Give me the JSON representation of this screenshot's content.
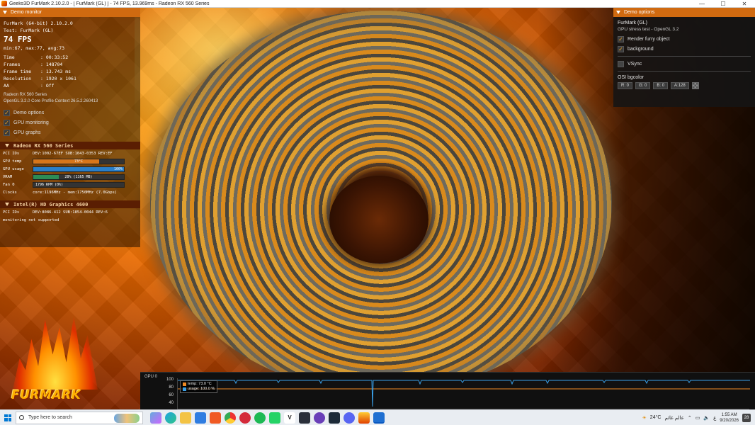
{
  "window": {
    "title": "Geeks3D FurMark 2.10.2.0 - [ FurMark (GL) ] - 74 FPS, 13.969ms - Radeon RX 560 Series",
    "minimize": "—",
    "maximize": "☐",
    "close": "✕"
  },
  "monitor": {
    "header": "Demo monitor",
    "app_line": "FurMark (64-bit) 2.10.2.0",
    "test_line": "Test: FurMark (GL)",
    "fps": "74 FPS",
    "fps_stats": "min:67, max:77, avg:73",
    "stats": [
      {
        "k": "Time",
        "v": ": 00:33:52"
      },
      {
        "k": "Frames",
        "v": ": 148704"
      },
      {
        "k": "Frame time",
        "v": ": 13.743 ms"
      },
      {
        "k": "Resolution",
        "v": ": 1920 x 1061"
      },
      {
        "k": "AA",
        "v": ": Off"
      }
    ],
    "gpu_name": "Radeon RX 560 Series",
    "opengl": "OpenGL 3.2.0 Core Profile Context 26.5.2.260413",
    "checks": [
      {
        "label": "Demo options",
        "checked": true
      },
      {
        "label": "GPU monitoring",
        "checked": true
      },
      {
        "label": "GPU graphs",
        "checked": true
      }
    ],
    "gpu1": {
      "header": "Radeon RX 560 Series",
      "pci_key": "PCI IDs",
      "pci_val": "DEV:1002-67EF SUB:1043-0353 REV:EF",
      "temp_key": "GPU temp",
      "temp_val": "73°C",
      "temp_frac": 0.73,
      "usage_key": "GPU usage",
      "usage_val": "100%",
      "usage_frac": 1.0,
      "vram_key": "VRAM",
      "vram_val": "28% (1165 MB)",
      "vram_frac": 0.28,
      "fan_key": "Fan 0",
      "fan_val": "1796 RPM (0%)",
      "clocks_key": "Clocks",
      "clocks_val": "core:1196MHz - mem:1750MHz (7.0Gbps)"
    },
    "gpu2": {
      "header": "Intel(R) HD Graphics 4600",
      "pci_key": "PCI IDs",
      "pci_val": "DEV:8086-412 SUB:1854-0044 REV:6",
      "note": "monitoring not supported"
    }
  },
  "logo": {
    "word": "FURMARK"
  },
  "options": {
    "header": "Demo options",
    "title": "FurMark (GL)",
    "subtitle": "GPU stress test - OpenGL 3.2",
    "checks": [
      {
        "label": "Render furry object",
        "checked": true
      },
      {
        "label": "background",
        "checked": true
      }
    ],
    "vsync": "VSync",
    "bgcolor_label": "OSI bgcolor",
    "bgcolor": [
      "R: 0",
      "G: 0",
      "B: 0",
      "A:128"
    ]
  },
  "graph": {
    "label": "GPU 0",
    "yticks": [
      "100",
      "80",
      "60",
      "40"
    ],
    "legend": [
      {
        "name": "temp: 73.0 °C",
        "color": "#f08a24"
      },
      {
        "name": "usage: 100.0 %",
        "color": "#3aa0e8"
      }
    ]
  },
  "taskbar": {
    "search_placeholder": "Type here to search",
    "weather": "24°C",
    "weather_text": "عالم غائم",
    "lang": "ع",
    "time": "1:55 AM",
    "date": "9/20/2026",
    "notif_count": "28",
    "icons": [
      "copilot-icon",
      "edge-icon",
      "file-explorer-icon",
      "store-icon",
      "brave-icon",
      "chrome-icon",
      "app-red-icon",
      "spotify-icon",
      "whatsapp-icon",
      "vk-icon",
      "app-dark-icon",
      "app-purple-icon",
      "app-terminal-icon",
      "discord-icon",
      "furmark-icon",
      "app-window-icon"
    ]
  }
}
